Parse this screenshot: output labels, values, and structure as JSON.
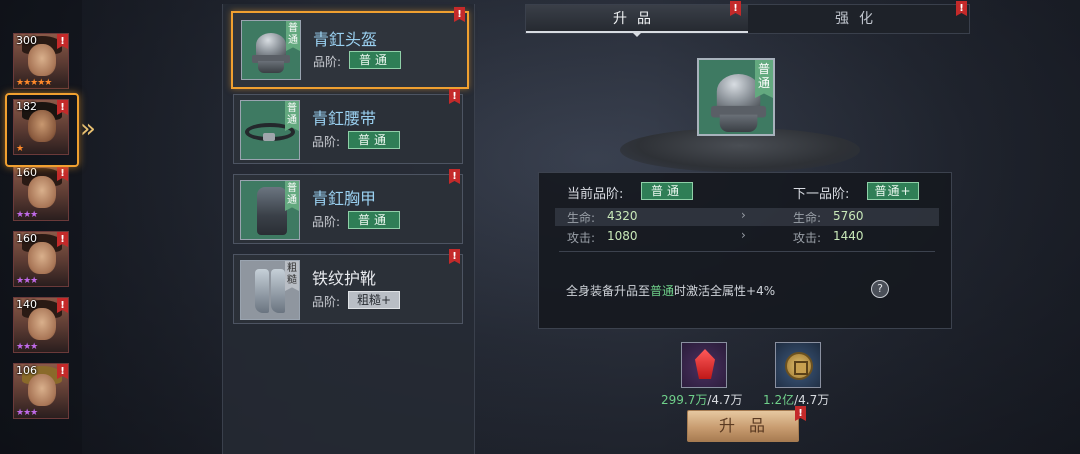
{
  "heroes": [
    {
      "level": "300",
      "stars": "★★★★★",
      "star_color": "gold",
      "selected": false
    },
    {
      "level": "182",
      "stars": "★",
      "star_color": "gold",
      "selected": true
    },
    {
      "level": "160",
      "stars": "★★★",
      "star_color": "purple",
      "selected": false
    },
    {
      "level": "160",
      "stars": "★★★",
      "star_color": "purple",
      "selected": false
    },
    {
      "level": "140",
      "stars": "★★★",
      "star_color": "purple",
      "selected": false
    },
    {
      "level": "106",
      "stars": "★★★",
      "star_color": "purple",
      "selected": false
    }
  ],
  "badge_mark": "!",
  "equipment": [
    {
      "name": "青釭头盔",
      "grade_label": "品阶:",
      "grade": "普通",
      "tag": "普通",
      "rarity": "green",
      "selected": true
    },
    {
      "name": "青釭腰带",
      "grade_label": "品阶:",
      "grade": "普通",
      "tag": "普通",
      "rarity": "green",
      "selected": false
    },
    {
      "name": "青釭胸甲",
      "grade_label": "品阶:",
      "grade": "普通",
      "tag": "普通",
      "rarity": "green",
      "selected": false
    },
    {
      "name": "铁纹护靴",
      "grade_label": "品阶:",
      "grade": "粗糙+",
      "tag": "粗糙",
      "rarity": "white",
      "selected": false
    }
  ],
  "tabs": {
    "upgrade": "升品",
    "enhance": "强化"
  },
  "detail": {
    "icon_tag": "普通",
    "current_label": "当前品阶:",
    "current_grade": "普通",
    "next_label": "下一品阶:",
    "next_grade": "普通+",
    "stats": [
      {
        "label": "生命:",
        "current": "4320",
        "next": "5760"
      },
      {
        "label": "攻击:",
        "current": "1080",
        "next": "1440"
      }
    ],
    "arrow": "›",
    "bonus_prefix": "全身装备升品至",
    "bonus_grade": "普通",
    "bonus_suffix": "时激活全属性+4%",
    "help": "?"
  },
  "costs": [
    {
      "have": "299.7万",
      "need": "/4.7万",
      "item": "red-gem-icon"
    },
    {
      "have": "1.2亿",
      "need": "/4.7万",
      "item": "coin-icon"
    }
  ],
  "upgrade_button": "升品",
  "colors": {
    "accent": "#f0a030",
    "green_grade": "#2f7e56",
    "badge": "#c42a2a",
    "value_green": "#6fd08a"
  }
}
